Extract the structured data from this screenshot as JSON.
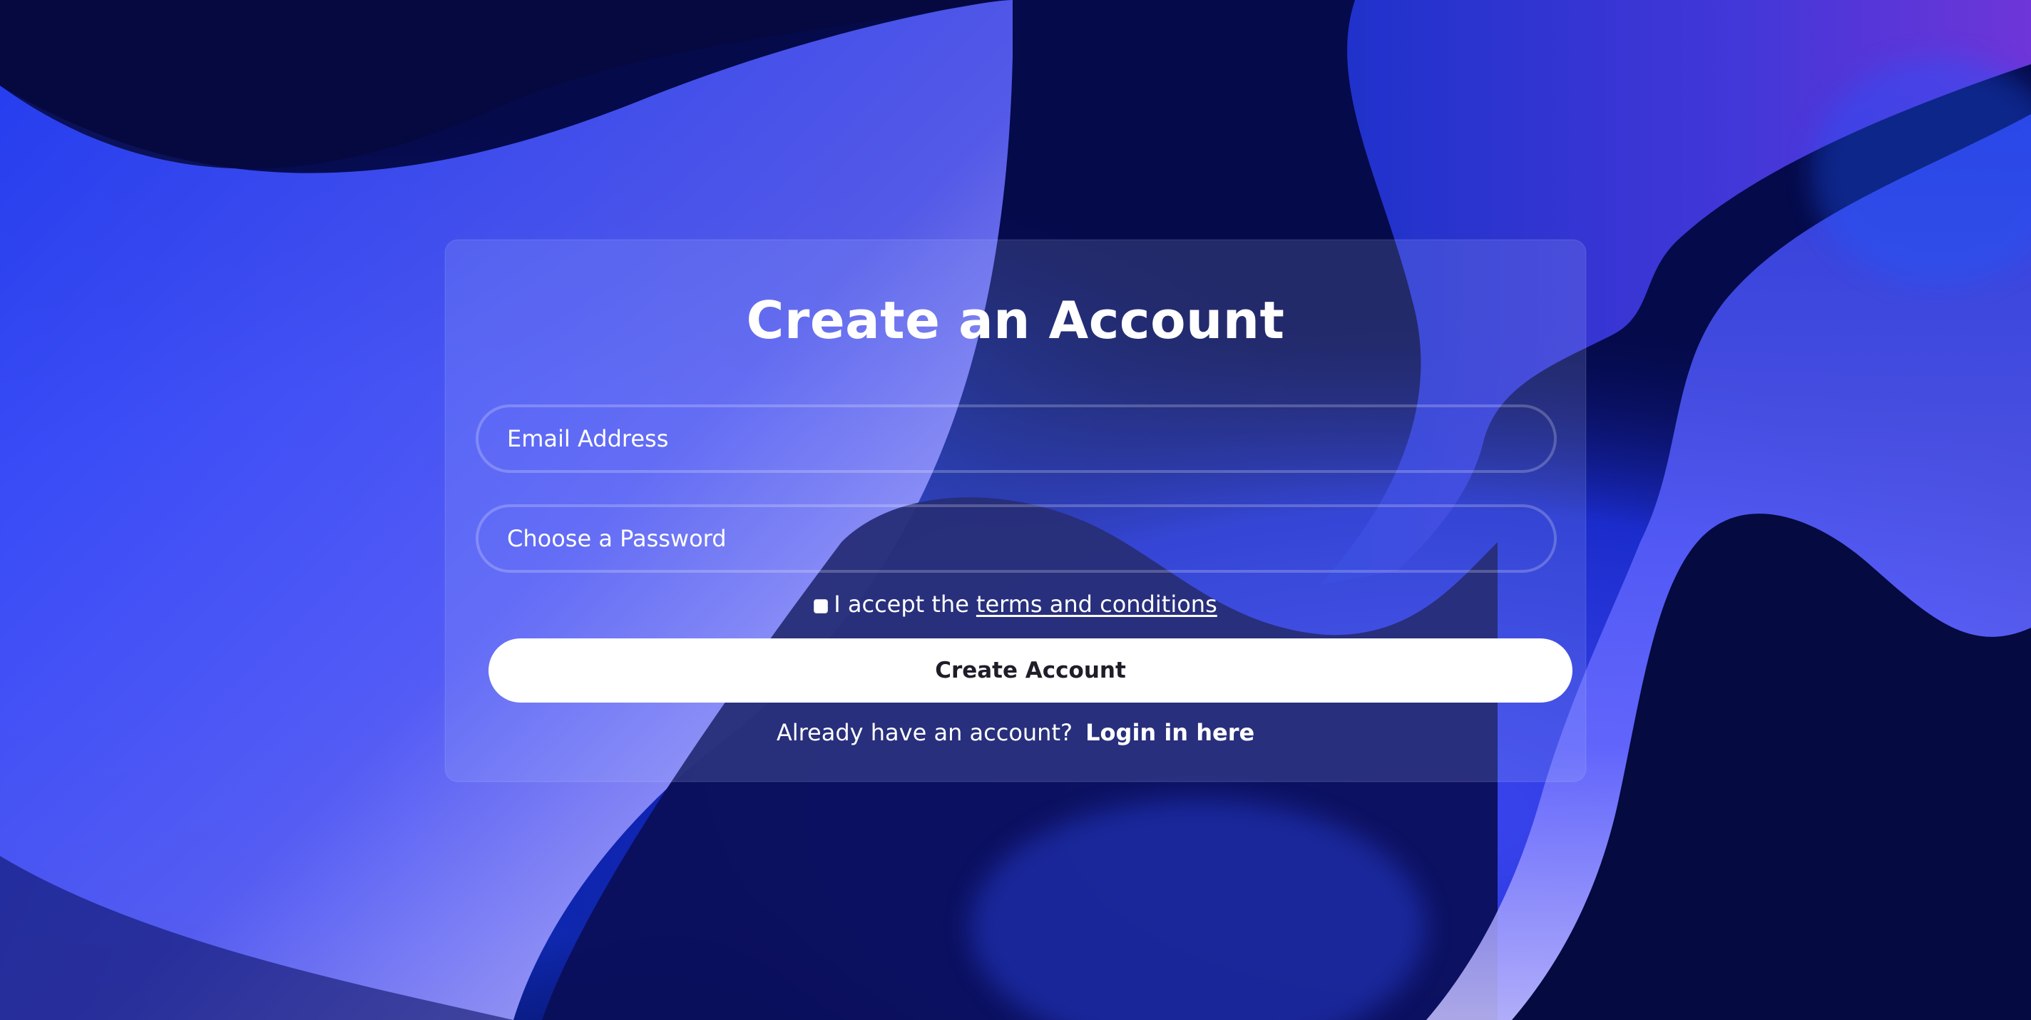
{
  "form": {
    "title": "Create an Account",
    "email_placeholder": "Email Address",
    "password_placeholder": "Choose a Password",
    "terms_prefix": "I accept the",
    "terms_link": "terms and conditions",
    "terms_checked": false,
    "submit_label": "Create Account",
    "login_prompt": "Already have an account?",
    "login_link": "Login in here"
  },
  "colors": {
    "background_deep": "#050a4a",
    "background_blue": "#1a3aff",
    "accent_purple": "#6a3cf0",
    "highlight_lavender": "#c8c2ff",
    "button_bg": "#ffffff",
    "button_text": "#1e1e2a"
  }
}
